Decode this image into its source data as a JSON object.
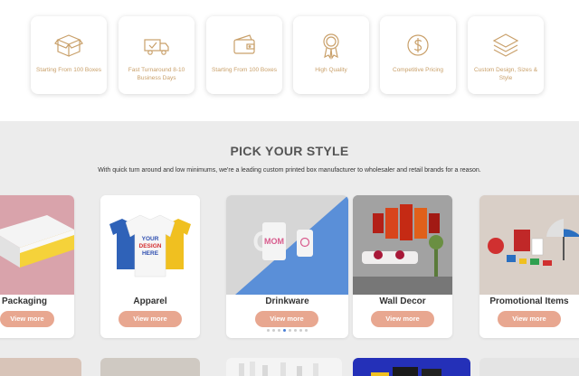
{
  "features": [
    {
      "icon": "box-icon",
      "text": "Starting From 100 Boxes"
    },
    {
      "icon": "delivery-truck-icon",
      "text": "Fast Turnaround 8-10 Business Days"
    },
    {
      "icon": "wallet-icon",
      "text": "Starting From 100 Boxes"
    },
    {
      "icon": "quality-badge-icon",
      "text": "High Quality"
    },
    {
      "icon": "dollar-coin-icon",
      "text": "Competitive Pricing"
    },
    {
      "icon": "layers-icon",
      "text": "Custom Design, Sizes & Style"
    }
  ],
  "section": {
    "title": "PICK YOUR STYLE",
    "subtitle": "With quick turn around and low minimums, we're a leading custom printed box manufacturer to wholesaler and retail brands for a reason."
  },
  "cards": [
    {
      "name": "Packaging",
      "button": "View more"
    },
    {
      "name": "Apparel",
      "button": "View more",
      "image_text": "YOUR DESIGN HERE"
    },
    {
      "name": "Drinkware",
      "button": "View more",
      "image_text": "MOM"
    },
    {
      "name": "Wall Decor",
      "button": "View more"
    },
    {
      "name": "Promotional Items",
      "button": "View more"
    }
  ],
  "colors": {
    "accent": "#e8a790",
    "icon_gold": "#c9a06a",
    "section_bg": "#ececec",
    "carousel_active_dot": "#4a7fd6"
  }
}
